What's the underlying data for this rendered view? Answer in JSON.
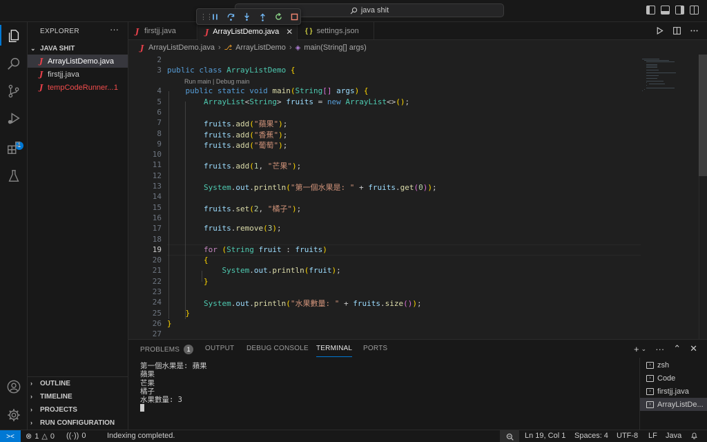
{
  "titlebar": {
    "nav_arrows": "‹ ›",
    "search_text": "java shit"
  },
  "debug_toolbar": {
    "controls": [
      "pause",
      "step-over",
      "step-into",
      "step-out",
      "restart",
      "stop"
    ]
  },
  "activity_bar": {
    "items": [
      "explorer",
      "search",
      "source-control",
      "run-and-debug",
      "extensions",
      "testing"
    ],
    "debug_badge": "1"
  },
  "sidebar": {
    "title": "EXPLORER",
    "more": "···",
    "folder": "JAVA SHIT",
    "files": [
      {
        "icon": "J",
        "name": "ArrayListDemo.java",
        "badge": ""
      },
      {
        "icon": "J",
        "name": "firstjj.java",
        "badge": ""
      },
      {
        "icon": "J",
        "name": "tempCodeRunner...",
        "badge": "1"
      }
    ],
    "sections": [
      "OUTLINE",
      "TIMELINE",
      "PROJECTS",
      "RUN CONFIGURATION"
    ]
  },
  "tabs": [
    {
      "icon": "J",
      "label": "firstjj.java"
    },
    {
      "icon": "J",
      "label": "ArrayListDemo.java",
      "close": "✕"
    },
    {
      "icon": "{ }",
      "label": "settings.json"
    }
  ],
  "breadcrumb": {
    "file_icon": "J",
    "file": "ArrayListDemo.java",
    "class_icon": "⎇",
    "class": "ArrayListDemo",
    "method_icon": "◈",
    "method": "main(String[] args)"
  },
  "editor": {
    "codelens": "Run main | Debug main",
    "current_line": "19",
    "line_numbers": [
      "2",
      "3",
      "4",
      "5",
      "6",
      "7",
      "8",
      "9",
      "10",
      "11",
      "12",
      "13",
      "14",
      "15",
      "16",
      "17",
      "18",
      "19",
      "20",
      "21",
      "22",
      "23",
      "24",
      "25",
      "26",
      "27"
    ],
    "lines": [
      "",
      "public class ArrayListDemo {",
      "    public static void main(String[] args) {",
      "        ArrayList<String> fruits = new ArrayList<>();",
      "",
      "        fruits.add(\"蘋果\");",
      "        fruits.add(\"香蕉\");",
      "        fruits.add(\"葡萄\");",
      "",
      "        fruits.add(1, \"芒果\");",
      "",
      "        System.out.println(\"第一個水果是: \" + fruits.get(0));",
      "",
      "        fruits.set(2, \"橘子\");",
      "",
      "        fruits.remove(3);",
      "",
      "        for (String fruit : fruits)",
      "        {",
      "            System.out.println(fruit);",
      "        }",
      "",
      "        System.out.println(\"水果數量: \" + fruits.size());",
      "    }",
      "}",
      ""
    ]
  },
  "panel": {
    "tabs": [
      {
        "label": "PROBLEMS",
        "badge": "1"
      },
      {
        "label": "OUTPUT"
      },
      {
        "label": "DEBUG CONSOLE"
      },
      {
        "label": "TERMINAL"
      },
      {
        "label": "PORTS"
      }
    ],
    "active_tab": "TERMINAL",
    "actions": [
      "+",
      "⌄",
      "···",
      "⌃",
      "✕"
    ],
    "terminal_output": [
      "第一個水果是: 蘋果",
      "蘋果",
      "芒果",
      "橘子",
      "水果數量: 3"
    ],
    "terminals": [
      "zsh",
      "Code",
      "firstjj.java",
      "ArrayListDe..."
    ]
  },
  "statusbar": {
    "remote_icon": "><",
    "errors": "1",
    "warnings": "0",
    "ports": "0",
    "message": "Indexing completed.",
    "position": "Ln 19, Col 1",
    "spaces": "Spaces: 4",
    "encoding": "UTF-8",
    "eol": "LF",
    "language": "Java"
  },
  "colors": {
    "accent": "#0078d4",
    "error": "#f14c4c",
    "java_icon": "#e8404a"
  }
}
